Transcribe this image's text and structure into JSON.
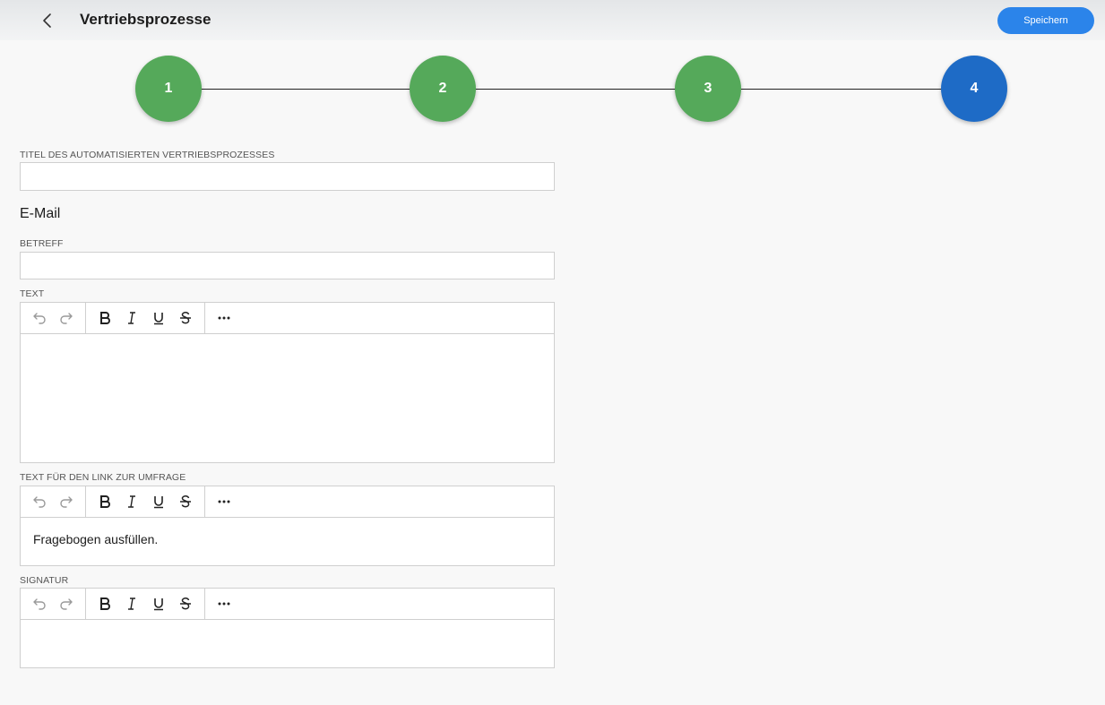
{
  "header": {
    "title": "Vertriebsprozesse",
    "save_label": "Speichern"
  },
  "stepper": {
    "steps": [
      {
        "label": "1",
        "state": "done"
      },
      {
        "label": "2",
        "state": "done"
      },
      {
        "label": "3",
        "state": "done"
      },
      {
        "label": "4",
        "state": "active"
      }
    ],
    "colors": {
      "done": "#55a95a",
      "active": "#1e6bc6"
    }
  },
  "form": {
    "title_label": "TITEL DES AUTOMATISIERTEN VERTRIEBSPROZESSES",
    "title_value": "",
    "email_heading": "E-Mail",
    "subject_label": "BETREFF",
    "subject_value": "",
    "text_label": "TEXT",
    "text_value": "",
    "link_label": "TEXT FÜR DEN LINK ZUR UMFRAGE",
    "link_value": "Fragebogen ausfüllen.",
    "signature_label": "SIGNATUR",
    "signature_value": ""
  },
  "toolbar_icons": [
    "undo-icon",
    "redo-icon",
    "bold-icon",
    "italic-icon",
    "underline-icon",
    "strikethrough-icon",
    "more-icon"
  ],
  "accent": "#2b84ea"
}
